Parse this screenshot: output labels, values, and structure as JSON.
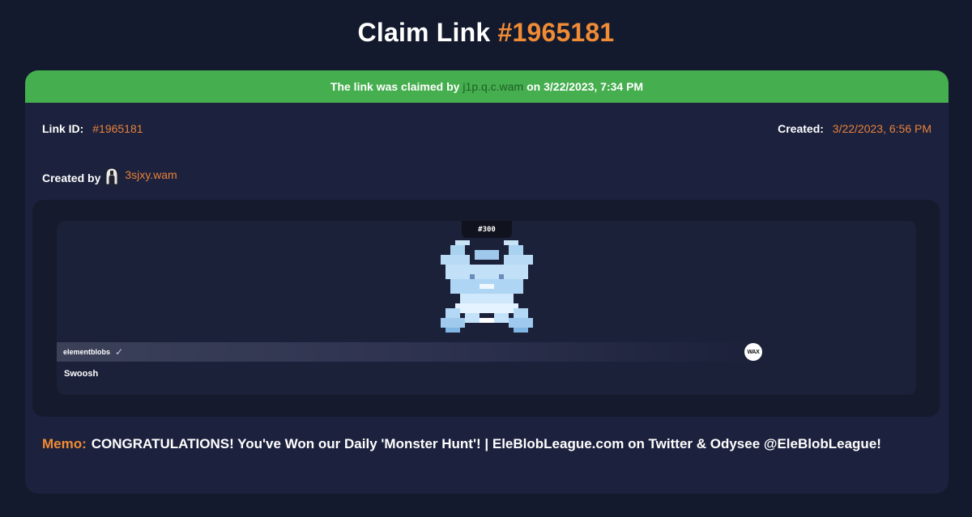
{
  "title": {
    "prefix": "Claim Link",
    "link_number": "#1965181"
  },
  "banner": {
    "text_before": "The link was claimed by",
    "claimer": "j1p.q.c.wam",
    "text_after": "on 3/22/2023, 7:34 PM"
  },
  "info": {
    "link_id_label": "Link ID:",
    "link_id_value": "#1965181",
    "created_label": "Created:",
    "created_value": "3/22/2023, 6:56 PM"
  },
  "creator": {
    "label": "Created by",
    "account": "3sjxy.wam",
    "avatar_icon": "helmet-avatar-icon"
  },
  "nft": {
    "mint_number": "#300",
    "collection": "elementblobs",
    "verified_icon": "check-icon",
    "marketplace_icon": "wax-logo-icon",
    "marketplace_text": "WAX",
    "name": "Swoosh"
  },
  "memo": {
    "label": "Memo:",
    "text": "CONGRATULATIONS! You've Won our Daily 'Monster Hunt'! | EleBlobLeague.com on Twitter & Odysee @EleBlobLeague!"
  },
  "colors": {
    "background": "#141a2d",
    "card": "#1c213d",
    "accent_orange": "#f08b36",
    "banner_green": "#45ae4e"
  }
}
